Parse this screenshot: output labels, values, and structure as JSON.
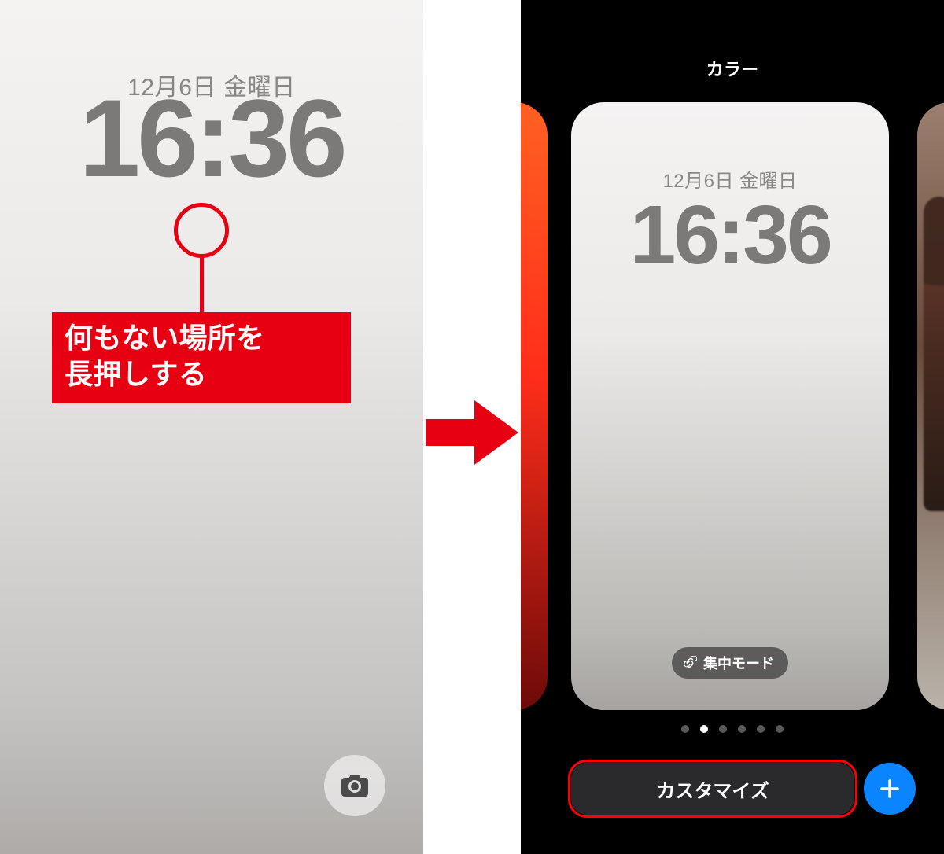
{
  "left": {
    "date": "12月6日 金曜日",
    "time": "16:36",
    "annotation": "何もない場所を\n長押しする"
  },
  "arrow_color": "#e60012",
  "right": {
    "title": "カラー",
    "preview": {
      "date": "12月6日 金曜日",
      "time": "16:36",
      "focus_label": "集中モード"
    },
    "page_count": 6,
    "active_page_index": 1,
    "customize_label": "カスタマイズ"
  }
}
